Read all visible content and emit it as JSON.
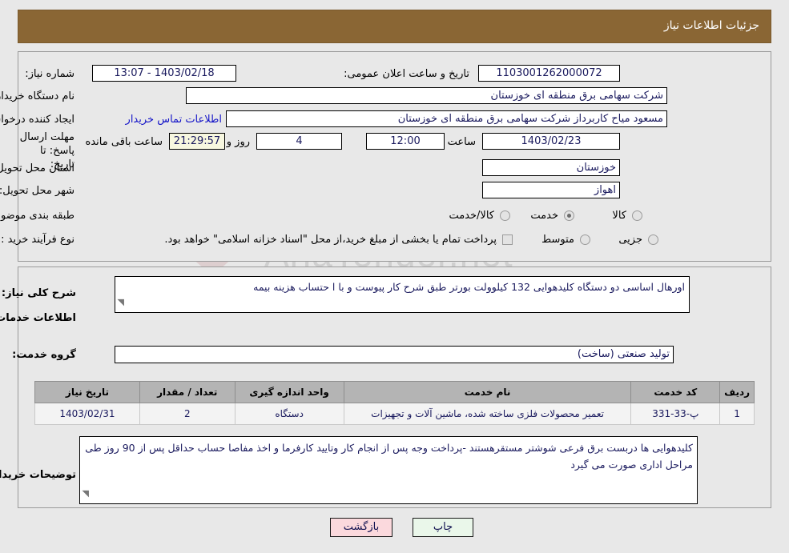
{
  "header": {
    "title": "جزئیات اطلاعات نیاز"
  },
  "form": {
    "need_number_label": "شماره نیاز:",
    "need_number_value": "1103001262000072",
    "announce_datetime_label": "تاریخ و ساعت اعلان عمومی:",
    "announce_datetime_value": "1403/02/18 - 13:07",
    "buyer_org_label": "نام دستگاه خریدار:",
    "buyer_org_value": "شرکت سهامی برق منطقه ای خوزستان",
    "requester_label": "ایجاد کننده درخواست:",
    "requester_value": "مسعود میاح کاربرداز شرکت سهامی برق منطقه ای خوزستان",
    "contact_link": "اطلاعات تماس خریدار",
    "deadline_label": "مهلت ارسال پاسخ: تا تاریخ:",
    "deadline_date": "1403/02/23",
    "hour_label": "ساعت",
    "hour_value": "12:00",
    "days_value": "4",
    "days_label": "روز و",
    "countdown_value": "21:29:57",
    "countdown_label": "ساعت باقی مانده",
    "province_label": "استان محل تحویل:",
    "province_value": "خوزستان",
    "city_label": "شهر محل تحویل:",
    "city_value": "اهواز",
    "category_label": "طبقه بندی موضوعی:",
    "category_options": [
      {
        "label": "کالا",
        "checked": false
      },
      {
        "label": "خدمت",
        "checked": true
      },
      {
        "label": "کالا/خدمت",
        "checked": false
      }
    ],
    "purchase_type_label": "نوع فرآیند خرید :",
    "purchase_type_options": [
      {
        "label": "جزیی",
        "checked": false
      },
      {
        "label": "متوسط",
        "checked": false
      }
    ],
    "treasury_checkbox_label": "پرداخت تمام یا بخشی از مبلغ خرید،از محل \"اسناد خزانه اسلامی\" خواهد بود.",
    "treasury_checked": false
  },
  "description": {
    "general_need_label": "شرح کلی نیاز:",
    "general_need_value": "اورهال اساسی دو دستگاه کلیدهوایی 132 کیلوولت بورتر طبق شرح کار پیوست و با ا حتساب هزینه بیمه",
    "services_info_heading": "اطلاعات خدمات مورد نیاز",
    "service_group_label": "گروه خدمت:",
    "service_group_value": "تولید صنعتی (ساخت)"
  },
  "table": {
    "columns": [
      "ردیف",
      "کد خدمت",
      "نام خدمت",
      "واحد اندازه گیری",
      "تعداد / مقدار",
      "تاریخ نیاز"
    ],
    "rows": [
      {
        "row": "1",
        "code": "پ-33-331",
        "name": "تعمیر محصولات فلزی ساخته شده، ماشین آلات و تجهیزات",
        "unit": "دستگاه",
        "quantity": "2",
        "date": "1403/02/31"
      }
    ]
  },
  "buyer_notes": {
    "label": "توضیحات خریدار:",
    "value": "کلیدهوایی ها دربست برق فرعی شوشتر مستقرهستند -پرداخت وجه پس از انجام کار وتایید کارفرما و اخذ مفاصا حساب حداقل پس از 90 روز طی مراحل اداری صورت می گیرد"
  },
  "footer": {
    "print_label": "چاپ",
    "back_label": "بازگشت"
  },
  "watermark": {
    "text": "AriaTender.net"
  },
  "colors": {
    "header_bar": "#8a6634",
    "header_text": "#ffffff",
    "page_bg": "#e8e8e8",
    "field_text": "#1a1a5e",
    "link": "#1414c8",
    "table_header": "#b4b4b4",
    "btn_print": "#eaf7ea",
    "btn_back": "#fbd9dd",
    "countdown_bg": "#f7f7e0"
  }
}
